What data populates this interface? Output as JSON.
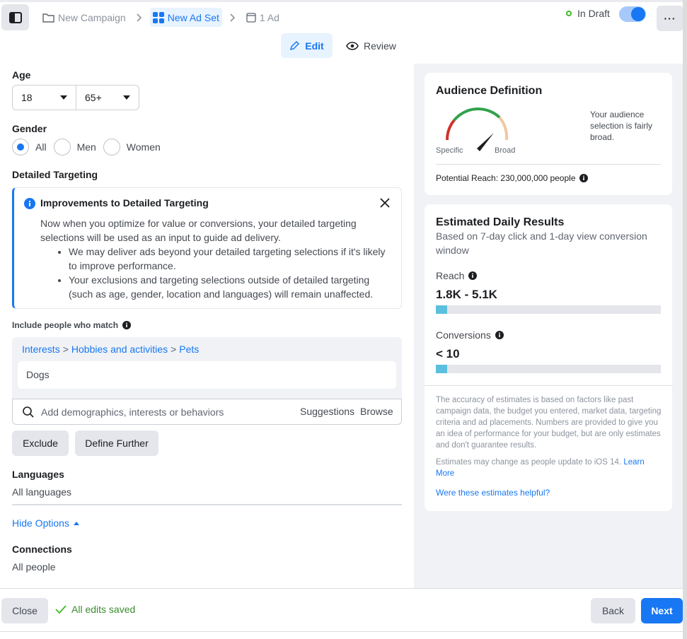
{
  "header": {
    "breadcrumbs": [
      {
        "label": "New Campaign",
        "icon": "folder-icon"
      },
      {
        "label": "New Ad Set",
        "icon": "grid-icon",
        "active": true
      },
      {
        "label": "1 Ad",
        "icon": "ad-icon"
      }
    ],
    "status": "In Draft",
    "toggle_on": true,
    "tabs": {
      "edit": "Edit",
      "review": "Review"
    }
  },
  "targeting": {
    "age_label": "Age",
    "age_min": "18",
    "age_max": "65+",
    "gender_label": "Gender",
    "genders": [
      {
        "label": "All",
        "selected": true
      },
      {
        "label": "Men",
        "selected": false
      },
      {
        "label": "Women",
        "selected": false
      }
    ],
    "detailed_label": "Detailed Targeting",
    "notice": {
      "title": "Improvements to Detailed Targeting",
      "body": "Now when you optimize for value or conversions, your detailed targeting selections will be used as an input to guide ad delivery.",
      "bullets": [
        "We may deliver ads beyond your detailed targeting selections if it's likely to improve performance.",
        "Your exclusions and targeting selections outside of detailed targeting (such as age, gender, location and languages) will remain unaffected."
      ]
    },
    "include_label": "Include people who match",
    "path": [
      "Interests",
      "Hobbies and activities",
      "Pets"
    ],
    "selected_interest": "Dogs",
    "search_placeholder": "Add demographics, interests or behaviors",
    "suggestions": "Suggestions",
    "browse": "Browse",
    "exclude_btn": "Exclude",
    "define_btn": "Define Further",
    "languages_label": "Languages",
    "languages_value": "All languages",
    "hide_options": "Hide Options",
    "connections_label": "Connections",
    "connections_value": "All people"
  },
  "audience": {
    "title": "Audience Definition",
    "gauge_specific": "Specific",
    "gauge_broad": "Broad",
    "description": "Your audience selection is fairly broad.",
    "potential_reach": "Potential Reach: 230,000,000 people"
  },
  "estimates": {
    "title": "Estimated Daily Results",
    "subtitle": "Based on 7-day click and 1-day view conversion window",
    "reach_label": "Reach",
    "reach_value": "1.8K - 5.1K",
    "reach_fraction": 0.05,
    "conversions_label": "Conversions",
    "conversions_value": "< 10",
    "conversions_fraction": 0.05,
    "accuracy_note": "The accuracy of estimates is based on factors like past campaign data, the budget you entered, market data, targeting criteria and ad placements. Numbers are provided to give you an idea of performance for your budget, but are only estimates and don't guarantee results.",
    "ios_note": "Estimates may change as people update to iOS 14.",
    "learn_more": "Learn More",
    "helpful": "Were these estimates helpful?"
  },
  "footer": {
    "close": "Close",
    "saved": "All edits saved",
    "back": "Back",
    "next": "Next"
  },
  "colors": {
    "accent": "#1877f2",
    "success": "#42b72a",
    "bar": "#5bc0de"
  }
}
